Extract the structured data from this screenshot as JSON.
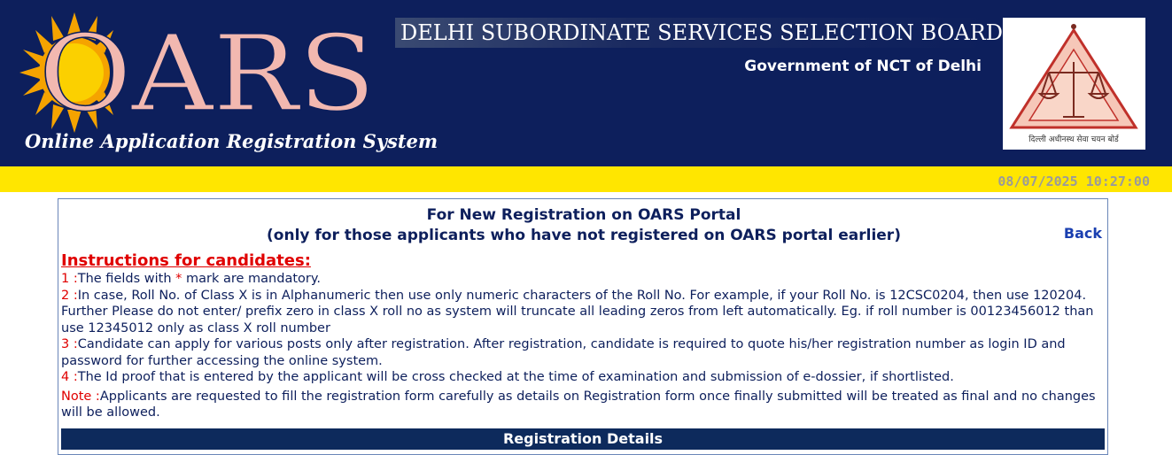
{
  "header": {
    "logo_text": "OARS",
    "tagline": "Online Application Registration System",
    "board_title": "DELHI SUBORDINATE SERVICES SELECTION BOARD",
    "government": "Government of NCT of Delhi",
    "emblem_text": "दिल्ली अधीनस्थ सेवा चयन बोर्ड"
  },
  "datetime": "08/07/2025 10:27:00",
  "panel": {
    "title_line1": "For New Registration on OARS Portal",
    "title_line2": "(only for those applicants who have not registered on OARS portal earlier)",
    "back_label": "Back",
    "instructions_heading": "Instructions for candidates:",
    "instructions": [
      {
        "num": "1 :",
        "text_a": "The fields with ",
        "req": "*",
        "text_b": " mark are mandatory."
      },
      {
        "num": "2 :",
        "text": "In case, Roll No. of Class X is in Alphanumeric then use only numeric characters of the Roll No. For example, if your Roll No. is 12CSC0204, then use 120204. Further Please do not enter/ prefix zero in class X roll no as system will truncate all leading zeros from left automatically. Eg. if roll number is 00123456012 than use 12345012 only as class X roll number"
      },
      {
        "num": "3 :",
        "text": "Candidate can apply for various posts only after registration. After registration, candidate is required to quote his/her registration number as login ID and password for further accessing the online system."
      },
      {
        "num": "4 :",
        "text": "The Id proof that is entered by the applicant will be cross checked at the time of examination and submission of e-dossier, if shortlisted."
      }
    ],
    "note_label": "Note :",
    "note_text": "Applicants are requested to fill the registration form carefully as details on Registration form once finally submitted will be treated as final and no changes will be allowed.",
    "section_bar": "Registration Details"
  },
  "colors": {
    "header_bg": "#0d1f5c",
    "yellow_bar": "#ffe600",
    "red": "#e00000",
    "logo_pink": "#f2b8b0",
    "sun_orange": "#f5a300"
  }
}
